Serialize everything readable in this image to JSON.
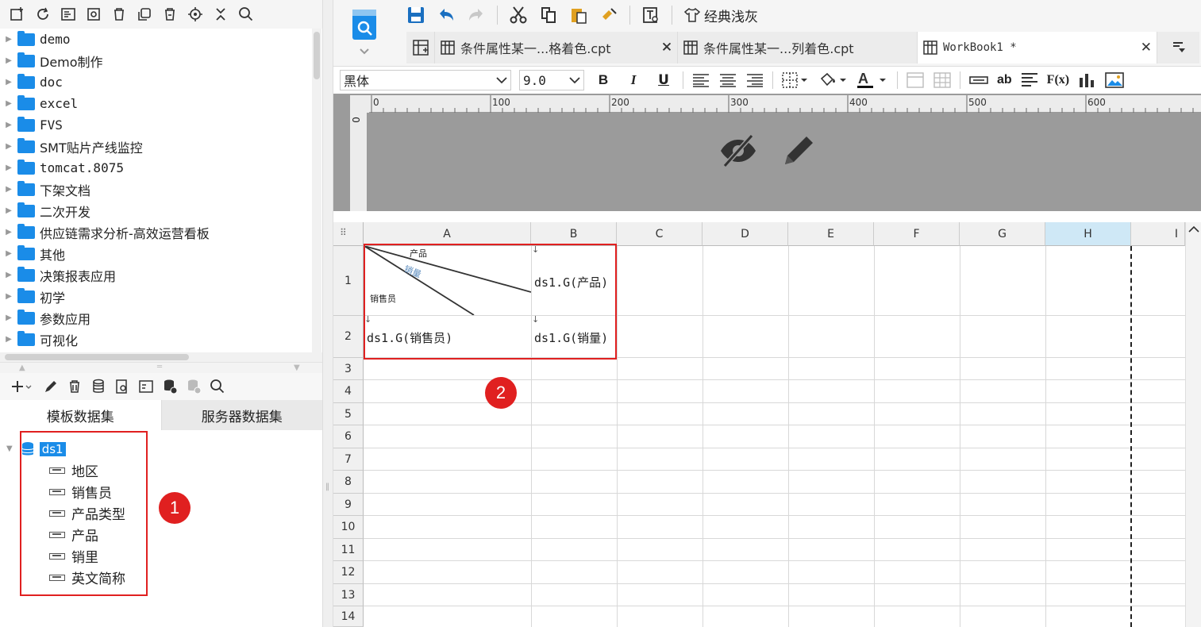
{
  "tree": {
    "items": [
      {
        "label": "demo"
      },
      {
        "label": "Demo制作"
      },
      {
        "label": "doc"
      },
      {
        "label": "excel"
      },
      {
        "label": "FVS"
      },
      {
        "label": "SMT贴片产线监控"
      },
      {
        "label": "tomcat.8075"
      },
      {
        "label": "下架文档"
      },
      {
        "label": "二次开发"
      },
      {
        "label": "供应链需求分析-高效运营看板"
      },
      {
        "label": "其他"
      },
      {
        "label": "决策报表应用"
      },
      {
        "label": "初学"
      },
      {
        "label": "参数应用"
      },
      {
        "label": "可视化"
      }
    ]
  },
  "dataset_tabs": {
    "template": "模板数据集",
    "server": "服务器数据集"
  },
  "dataset": {
    "name": "ds1",
    "fields": [
      {
        "label": "地区"
      },
      {
        "label": "销售员"
      },
      {
        "label": "产品类型"
      },
      {
        "label": "产品"
      },
      {
        "label": "销里"
      },
      {
        "label": "英文简称"
      }
    ]
  },
  "badges": {
    "one": "1",
    "two": "2"
  },
  "toolbar": {
    "theme_label": "经典浅灰"
  },
  "tabs": [
    {
      "label": "条件属性某一...格着色.cpt"
    },
    {
      "label": "条件属性某一...列着色.cpt"
    },
    {
      "label": "WorkBook1 *"
    }
  ],
  "format": {
    "font": "黑体",
    "size": "9.0",
    "bold": "B",
    "italic": "I",
    "underline": "U",
    "text_color": "A",
    "ab": "ab",
    "fx": "F(x)"
  },
  "ruler": {
    "marks": [
      "0",
      "100",
      "200",
      "300",
      "400",
      "500",
      "600"
    ],
    "v0": "0"
  },
  "columns": [
    "A",
    "B",
    "C",
    "D",
    "E",
    "F",
    "G",
    "H",
    "I"
  ],
  "rows": [
    "1",
    "2",
    "3",
    "4",
    "5",
    "6",
    "7",
    "8",
    "9",
    "10",
    "11",
    "12",
    "13",
    "14"
  ],
  "cells": {
    "a1_top": "产品",
    "a1_mid": "销量",
    "a1_bottom": "销售员",
    "b1": "ds1.G(产品)",
    "a2": "ds1.G(销售员)",
    "b2": "ds1.G(销量)"
  },
  "colors": {
    "accent": "#1a8ce8",
    "highlight": "#e02020",
    "selected_col": "#cfe8f6"
  }
}
